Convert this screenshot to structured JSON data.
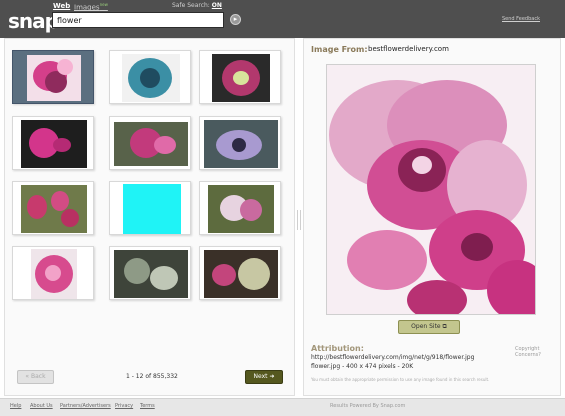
{
  "header": {
    "logo": "snap",
    "tab_web": "Web",
    "tab_images": "Images",
    "tab_images_badge": "new",
    "safe_search_label": "Safe Search:",
    "safe_search_value": "ON",
    "search_value": "flower",
    "send_feedback": "Send Feedback"
  },
  "results": {
    "count_text": "1 - 12 of 855,332",
    "back_label": "Back",
    "next_label": "Next"
  },
  "preview": {
    "image_from_label": "Image From:",
    "image_from_domain": "bestflowerdelivery.com",
    "open_site_label": "Open Site",
    "attribution_label": "Attribution:",
    "copyright_label": "Copyright Concerns?",
    "image_url": "http://bestflowerdelivery.com/img/net/g/918/flower.jpg",
    "image_meta": "flower.jpg - 400 x 474 pixels - 20K",
    "disclaimer": "You must obtain the appropriate permission to use any image found in this search result."
  },
  "footer": {
    "links": [
      "Help",
      "About Us",
      "Partners/Advertisers",
      "Privacy",
      "Terms"
    ],
    "note": "Results Powered By Snap.com"
  },
  "colors": {
    "header_bg": "#4f4f4f",
    "next_button": "#55581f",
    "open_site_button": "#c3c68e",
    "selected_thumb": "#5b6f80",
    "label_accent": "#8a7a5a"
  }
}
